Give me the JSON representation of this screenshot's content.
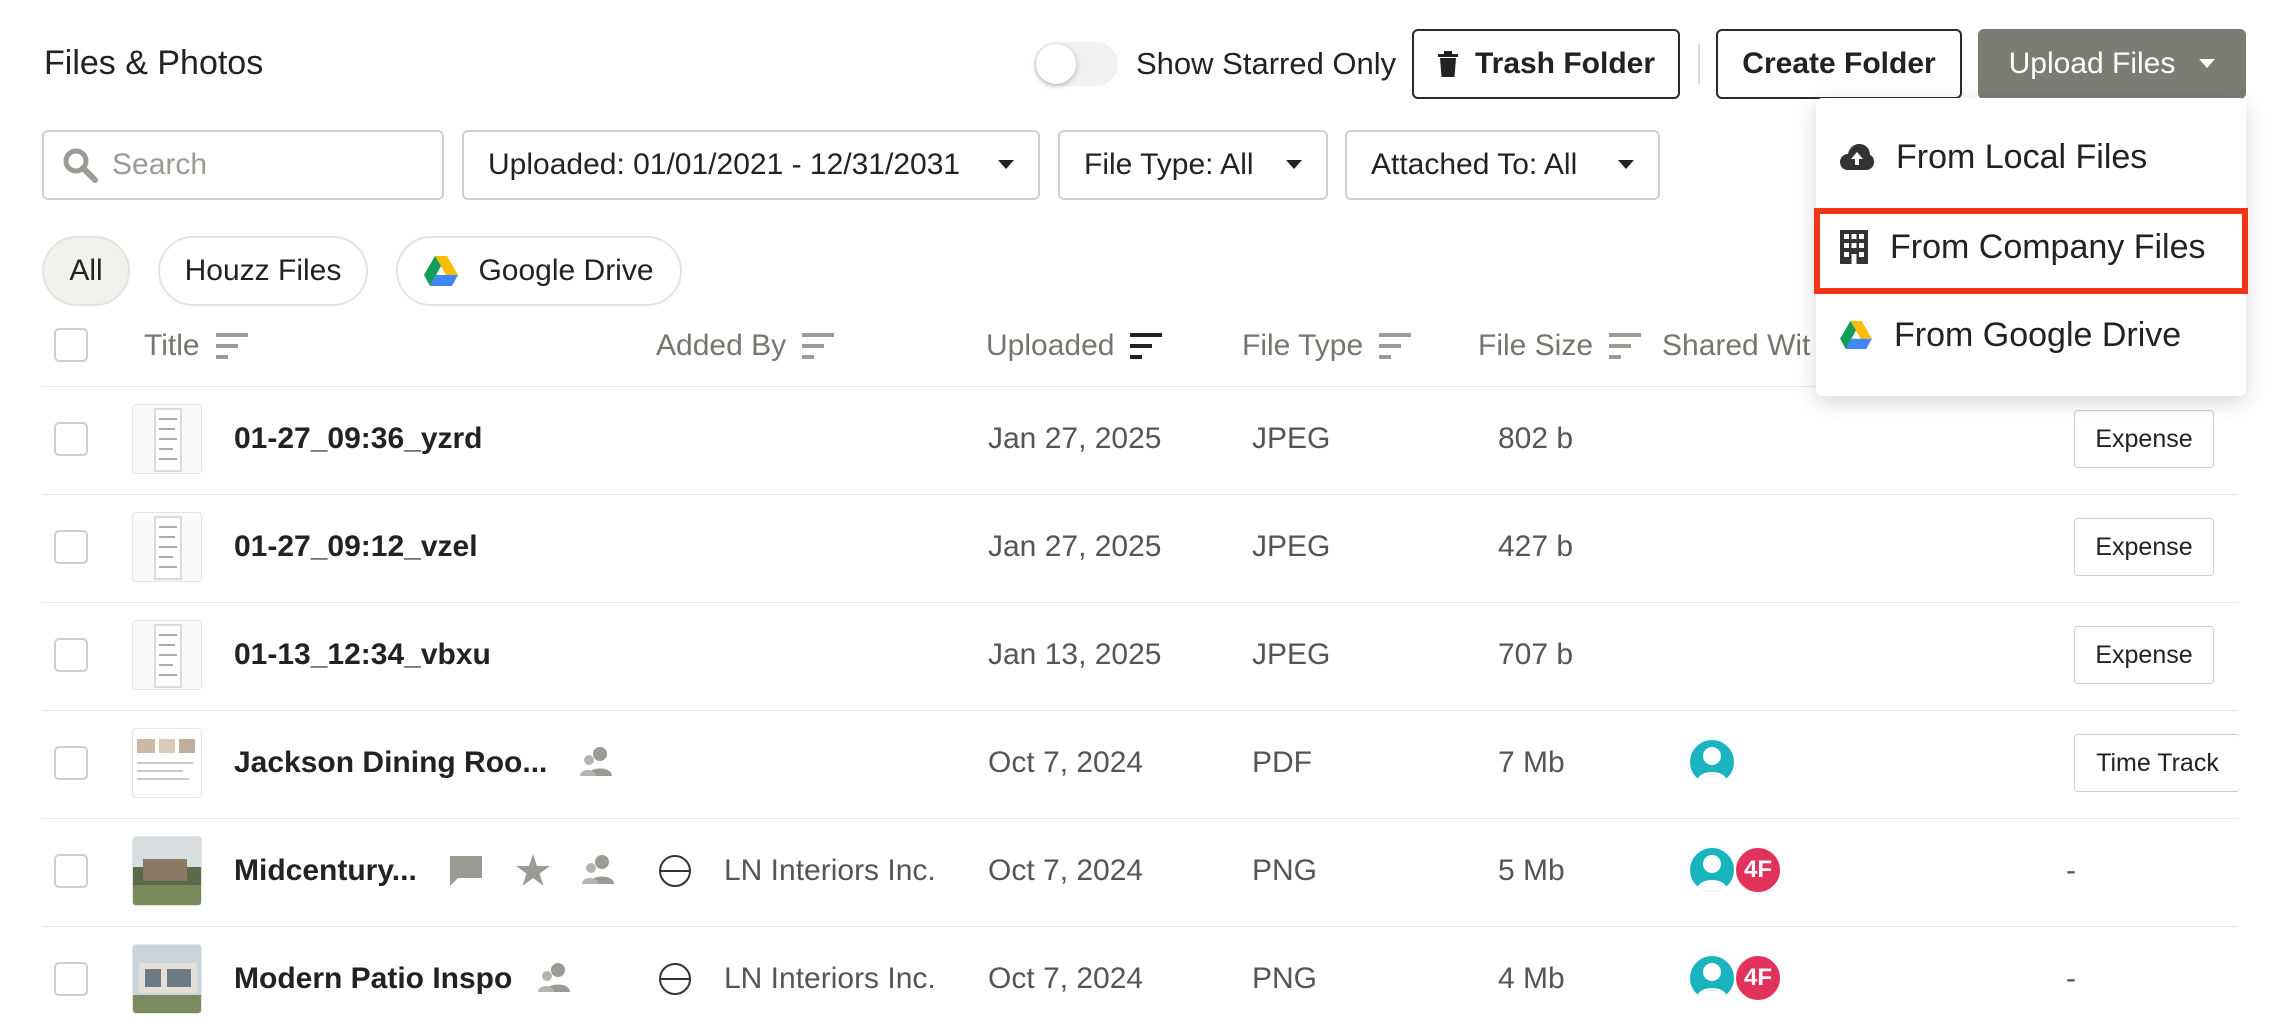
{
  "header": {
    "title": "Files & Photos",
    "show_starred_label": "Show Starred Only",
    "trash_folder": "Trash Folder",
    "create_folder": "Create Folder",
    "upload_files": "Upload Files"
  },
  "filters": {
    "search_placeholder": "Search",
    "uploaded": "Uploaded: 01/01/2021 - 12/31/2031",
    "file_type": "File Type: All",
    "attached_to": "Attached To: All"
  },
  "source_tabs": {
    "all": "All",
    "houzz": "Houzz Files",
    "gdrive": "Google Drive"
  },
  "columns": {
    "title": "Title",
    "added_by": "Added By",
    "uploaded": "Uploaded",
    "file_type": "File Type",
    "file_size": "File Size",
    "shared_with": "Shared Wit"
  },
  "upload_menu": {
    "local": "From Local Files",
    "company": "From Company Files",
    "gdrive": "From Google Drive"
  },
  "rows": [
    {
      "title": "01-27_09:36_yzrd",
      "added_by": "",
      "uploaded": "Jan 27, 2025",
      "type": "JPEG",
      "size": "802 b",
      "attached": "Expense"
    },
    {
      "title": "01-27_09:12_vzel",
      "added_by": "",
      "uploaded": "Jan 27, 2025",
      "type": "JPEG",
      "size": "427 b",
      "attached": "Expense"
    },
    {
      "title": "01-13_12:34_vbxu",
      "added_by": "",
      "uploaded": "Jan 13, 2025",
      "type": "JPEG",
      "size": "707 b",
      "attached": "Expense"
    },
    {
      "title": "Jackson Dining Roo...",
      "added_by": "",
      "uploaded": "Oct 7, 2024",
      "type": "PDF",
      "size": "7 Mb",
      "attached": "Time Track"
    },
    {
      "title": "Midcentury...",
      "added_by": "LN Interiors Inc.",
      "uploaded": "Oct 7, 2024",
      "type": "PNG",
      "size": "5 Mb",
      "attached": "-",
      "avatar_initials": "4F"
    },
    {
      "title": "Modern Patio Inspo",
      "added_by": "LN Interiors Inc.",
      "uploaded": "Oct 7, 2024",
      "type": "PNG",
      "size": "4 Mb",
      "attached": "-",
      "avatar_initials": "4F"
    }
  ]
}
